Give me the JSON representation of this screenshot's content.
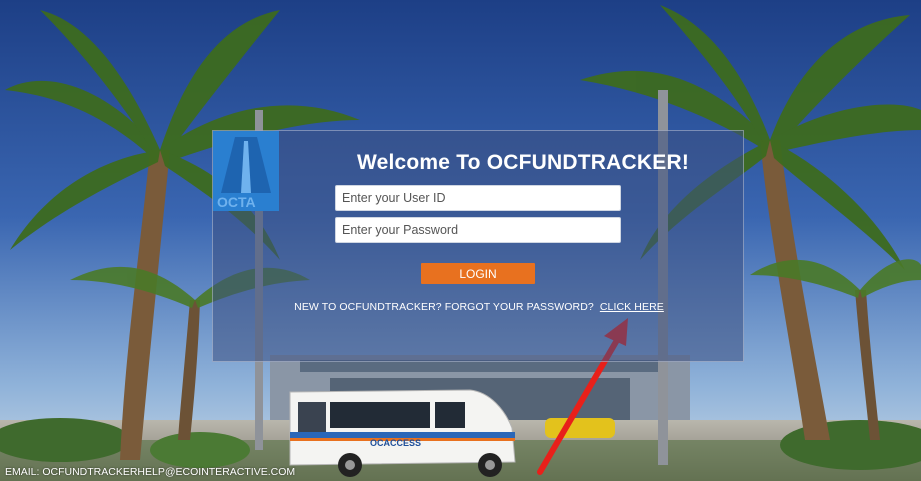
{
  "login": {
    "title": "Welcome To OCFUNDTRACKER!",
    "user_id_placeholder": "Enter your User ID",
    "password_placeholder": "Enter your Password",
    "login_label": "LOGIN",
    "help_prefix": "NEW TO OCFUNDTRACKER? FORGOT YOUR PASSWORD?",
    "help_link": "CLICK HERE"
  },
  "logo": {
    "text": "OCTA",
    "color": "#2a7fd0"
  },
  "bus": {
    "brand": "OCACCESS"
  },
  "footer": {
    "email": "EMAIL: OCFUNDTRACKERHELP@ECOINTERACTIVE.COM"
  },
  "colors": {
    "panel": "#3c5082",
    "button": "#e8711f",
    "arrow": "#e8201a"
  }
}
